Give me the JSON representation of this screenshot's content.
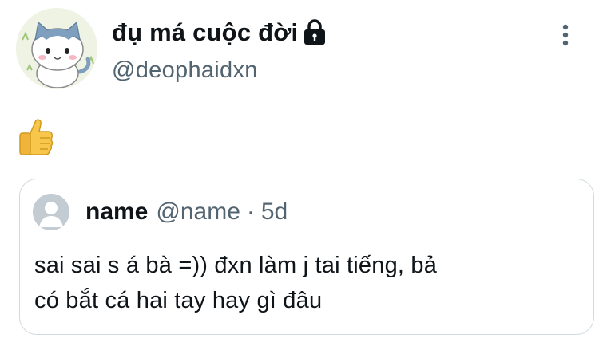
{
  "author": {
    "display_name": "đụ má cuộc đời",
    "handle": "@deophaidxn",
    "avatar": "cat-character-avatar",
    "protected_icon": "lock-icon"
  },
  "menu": {
    "icon": "more-options-icon"
  },
  "post": {
    "emoji": "👍",
    "emoji_name": "thumbs-up-emoji"
  },
  "quoted": {
    "avatar": "default-user-avatar",
    "name": "name",
    "handle": "@name",
    "separator": "·",
    "time": "5d",
    "text_line_1": "sai sai s á bà =)) đxn làm j tai tiếng, bả",
    "text_line_2": "có bắt cá hai tay hay gì đâu"
  },
  "colors": {
    "text_primary": "#0f1419",
    "text_secondary": "#536471",
    "border": "#cfd9de",
    "default_avatar_bg": "#c4ccd3",
    "default_avatar_fg": "#ffffff"
  }
}
